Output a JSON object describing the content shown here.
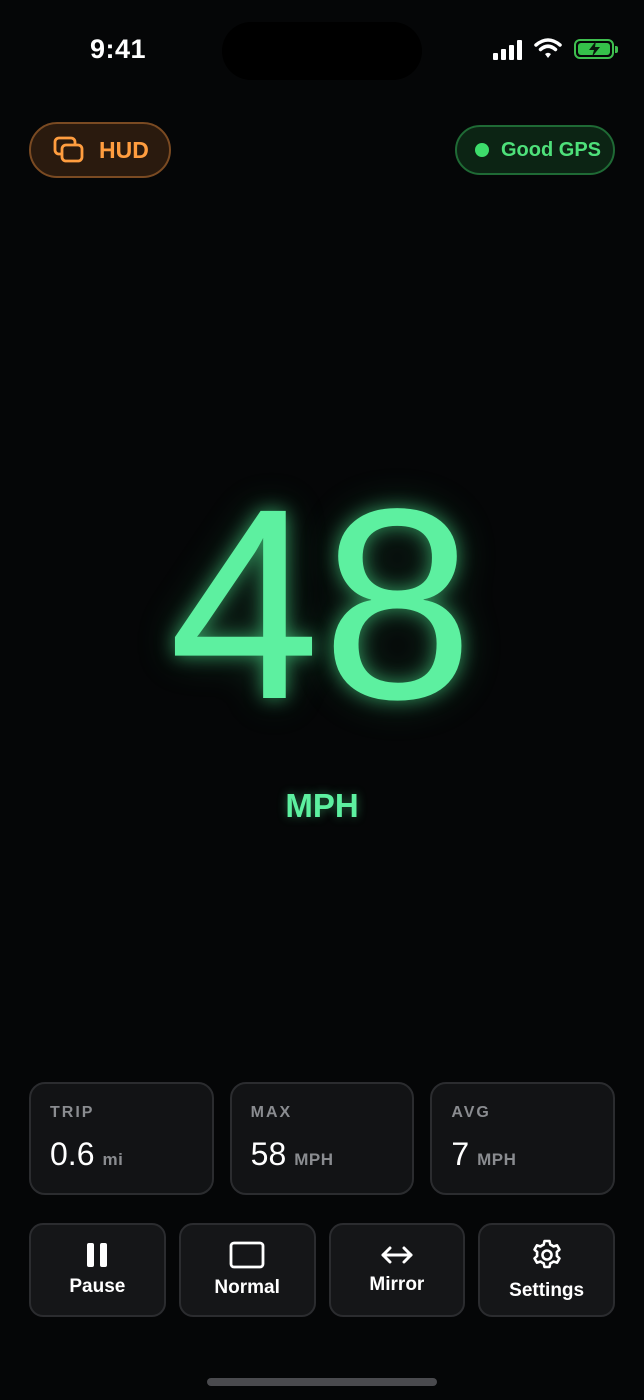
{
  "status_bar": {
    "time": "9:41",
    "icons": [
      "cellular-signal-icon",
      "wifi-icon",
      "battery-charging-icon"
    ],
    "battery_color": "#35c14a"
  },
  "header": {
    "hud_button": {
      "label": "HUD",
      "icon": "hud-layers-icon",
      "color": "#ff9d3f"
    },
    "gps_status": {
      "label": "Good GPS",
      "color": "#3ddc6b"
    }
  },
  "speedometer": {
    "speed": "48",
    "unit": "MPH",
    "color": "#5df0a0"
  },
  "stats": [
    {
      "label": "TRIP",
      "value": "0.6",
      "unit": "mi"
    },
    {
      "label": "MAX",
      "value": "58",
      "unit": "MPH"
    },
    {
      "label": "AVG",
      "value": "7",
      "unit": "MPH"
    }
  ],
  "controls": [
    {
      "label": "Pause",
      "icon": "pause-icon"
    },
    {
      "label": "Normal",
      "icon": "rectangle-icon"
    },
    {
      "label": "Mirror",
      "icon": "mirror-arrows-icon"
    },
    {
      "label": "Settings",
      "icon": "gear-icon"
    }
  ]
}
